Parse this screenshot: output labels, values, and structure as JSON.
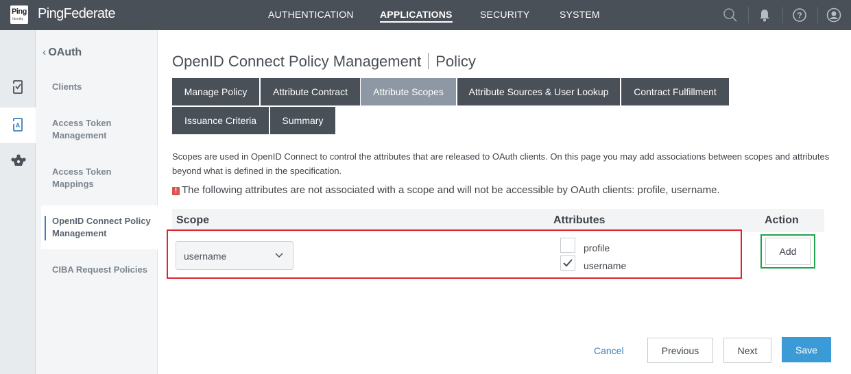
{
  "header": {
    "logo_text": "Ping",
    "logo_sub": "Identity",
    "brand_name": "PingFederate",
    "nav": [
      {
        "label": "AUTHENTICATION"
      },
      {
        "label": "APPLICATIONS",
        "active": true
      },
      {
        "label": "SECURITY"
      },
      {
        "label": "SYSTEM"
      }
    ],
    "icons": [
      "search-icon",
      "bell-icon",
      "help-icon",
      "user-icon"
    ]
  },
  "rail": {
    "items": [
      "applications-icon",
      "oauth-icon",
      "network-icon"
    ]
  },
  "sidebar": {
    "back_label": "OAuth",
    "items": [
      {
        "label": "Clients"
      },
      {
        "label": "Access Token Management"
      },
      {
        "label": "Access Token Mappings"
      },
      {
        "label": "OpenID Connect Policy Management",
        "active": true
      },
      {
        "label": "CIBA Request Policies"
      }
    ]
  },
  "main": {
    "title": "OpenID Connect Policy Management",
    "subtitle": "Policy",
    "tabs": [
      {
        "label": "Manage Policy"
      },
      {
        "label": "Attribute Contract"
      },
      {
        "label": "Attribute Scopes",
        "active": true
      },
      {
        "label": "Attribute Sources & User Lookup"
      },
      {
        "label": "Contract Fulfillment"
      },
      {
        "label": "Issuance Criteria"
      },
      {
        "label": "Summary"
      }
    ],
    "description": "Scopes are used in OpenID Connect to control the attributes that are released to OAuth clients. On this page you may add associations between scopes and attributes beyond what is defined in the specification.",
    "warning": "The following attributes are not associated with a scope and will not be accessible by OAuth clients: profile, username.",
    "warning_icon": "!",
    "table": {
      "columns": [
        "Scope",
        "Attributes",
        "Action"
      ],
      "scope_value": "username",
      "attributes": [
        {
          "label": "profile",
          "checked": false
        },
        {
          "label": "username",
          "checked": true
        }
      ],
      "add_label": "Add"
    }
  },
  "footer": {
    "cancel_label": "Cancel",
    "previous_label": "Previous",
    "next_label": "Next",
    "save_label": "Save"
  },
  "colors": {
    "topbar": "#4a5058",
    "active_tab": "#8d98a4",
    "primary": "#3b9bd6",
    "highlight_red": "#e0242f",
    "highlight_green": "#1fa24a"
  }
}
